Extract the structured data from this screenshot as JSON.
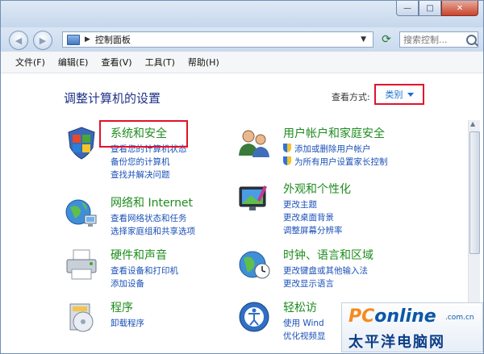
{
  "window": {
    "caption_minimize": "—",
    "caption_maximize": "□",
    "caption_close": "✕"
  },
  "nav": {
    "back_glyph": "◀",
    "forward_glyph": "▶",
    "address_sep": "▶",
    "address_path": "控制面板",
    "address_dropdown": "▼",
    "refresh_glyph": "⟳",
    "search_placeholder": "搜索控制..."
  },
  "menubar": [
    "文件(F)",
    "编辑(E)",
    "查看(V)",
    "工具(T)",
    "帮助(H)"
  ],
  "page": {
    "heading": "调整计算机的设置",
    "view_by_label": "查看方式:",
    "view_by_value": "类别"
  },
  "categories": {
    "system": {
      "title": "系统和安全",
      "links": [
        "查看您的计算机状态",
        "备份您的计算机",
        "查找并解决问题"
      ],
      "icon": "shield-flag-icon"
    },
    "network": {
      "title": "网络和 Internet",
      "links": [
        "查看网络状态和任务",
        "选择家庭组和共享选项"
      ],
      "icon": "network-globe-icon"
    },
    "hardware": {
      "title": "硬件和声音",
      "links": [
        "查看设备和打印机",
        "添加设备"
      ],
      "icon": "printer-icon"
    },
    "programs": {
      "title": "程序",
      "links": [
        "卸载程序"
      ],
      "icon": "programs-disc-icon"
    },
    "users": {
      "title": "用户帐户和家庭安全",
      "links": [
        "添加或删除用户帐户",
        "为所有用户设置家长控制"
      ],
      "icon": "users-icon"
    },
    "appearance": {
      "title": "外观和个性化",
      "links": [
        "更改主题",
        "更改桌面背景",
        "调整屏幕分辨率"
      ],
      "icon": "monitor-icon"
    },
    "clock": {
      "title": "时钟、语言和区域",
      "links": [
        "更改键盘或其他输入法",
        "更改显示语言"
      ],
      "icon": "globe-clock-icon"
    },
    "ease": {
      "title": "轻松访",
      "links": [
        "使用 Wind",
        "优化视频显"
      ],
      "icon": "ease-of-access-icon"
    }
  },
  "watermark": {
    "brand_a": "PC",
    "brand_b": "online",
    "domain": ".com.cn",
    "cn": "太平洋电脑网"
  },
  "colors": {
    "accent_red": "#e3122a",
    "link_blue": "#1a50b8",
    "title_green": "#1e8c1e",
    "heading_blue": "#1e3287"
  }
}
